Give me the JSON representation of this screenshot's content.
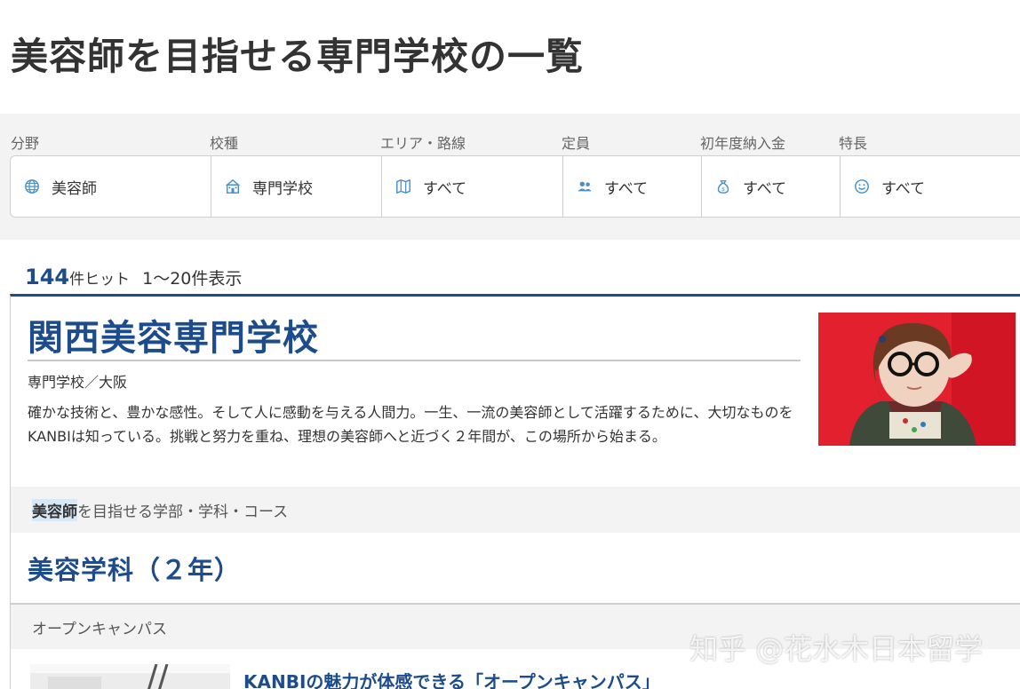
{
  "page": {
    "title": "美容師を目指せる専門学校の一覧"
  },
  "filters": [
    {
      "label": "分野",
      "value": "美容師",
      "icon": "globe-icon"
    },
    {
      "label": "校種",
      "value": "専門学校",
      "icon": "school-building-icon"
    },
    {
      "label": "エリア・路線",
      "value": "すべて",
      "icon": "map-icon"
    },
    {
      "label": "定員",
      "value": "すべて",
      "icon": "people-icon"
    },
    {
      "label": "初年度納入金",
      "value": "すべて",
      "icon": "money-bag-icon"
    },
    {
      "label": "特長",
      "value": "すべて",
      "icon": "smiley-icon"
    }
  ],
  "results": {
    "count": "144",
    "count_suffix": "件ヒット",
    "range": "1～20件表示"
  },
  "school": {
    "name": "関西美容専門学校",
    "type": "専門学校／大阪",
    "description": "確かな技術と、豊かな感性。そして人に感動を与える人間力。一生、一流の美容師として活躍するために、大切なものをKANBIは知っている。挑戦と努力を重ね、理想の美容師へと近づく２年間が、この場所から始まる。",
    "courses_heading_highlight": "美容師",
    "courses_heading_rest": "を目指せる学部・学科・コース",
    "course_title": "美容学科（２年）",
    "open_campus_label": "オープンキャンパス",
    "open_campus_link": "KANBIの魅力が体感できる「オープンキャンパス」"
  },
  "watermark": "知乎 @花水木日本留学",
  "colors": {
    "brand_blue": "#1d4c8c",
    "band_gray": "#f3f3f3",
    "photo_red": "#e01a2a"
  }
}
